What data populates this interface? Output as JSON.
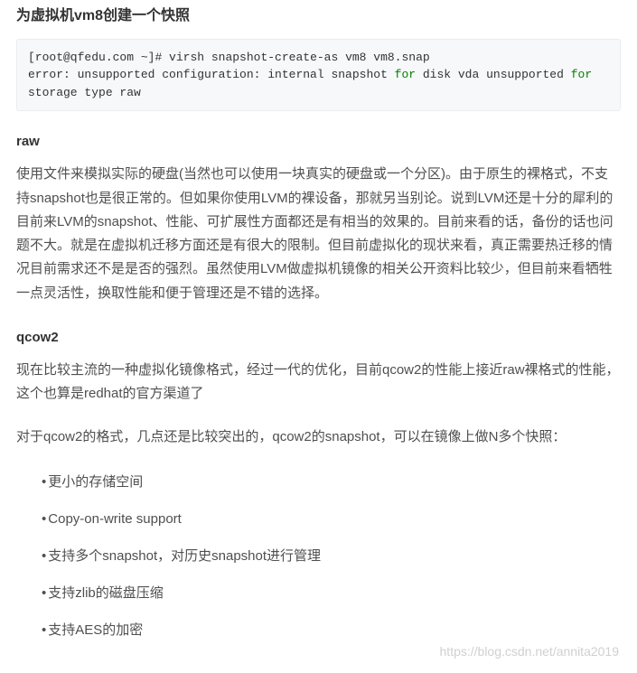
{
  "title": "为虚拟机vm8创建一个快照",
  "code": {
    "prompt": "[root@qfedu.com ~]",
    "command": "# virsh snapshot-create-as vm8 vm8.snap",
    "err_pre": "error: unsupported configuration: internal snapshot ",
    "kw1": "for",
    "err_mid": " disk vda unsupported ",
    "kw2": "for",
    "err_post": " storage type raw"
  },
  "raw": {
    "heading": "raw",
    "para": "使用文件来模拟实际的硬盘(当然也可以使用一块真实的硬盘或一个分区)。由于原生的裸格式，不支持snapshot也是很正常的。但如果你使用LVM的裸设备，那就另当别论。说到LVM还是十分的犀利的目前来LVM的snapshot、性能、可扩展性方面都还是有相当的效果的。目前来看的话，备份的话也问题不大。就是在虚拟机迁移方面还是有很大的限制。但目前虚拟化的现状来看，真正需要热迁移的情况目前需求还不是是否的强烈。虽然使用LVM做虚拟机镜像的相关公开资料比较少，但目前来看牺牲一点灵活性，换取性能和便于管理还是不错的选择。"
  },
  "qcow2": {
    "heading": "qcow2",
    "para1": "现在比较主流的一种虚拟化镜像格式，经过一代的优化，目前qcow2的性能上接近raw裸格式的性能，这个也算是redhat的官方渠道了",
    "para2": "对于qcow2的格式，几点还是比较突出的，qcow2的snapshot，可以在镜像上做N多个快照：",
    "items": [
      "更小的存储空间",
      "Copy-on-write support",
      "支持多个snapshot，对历史snapshot进行管理",
      "支持zlib的磁盘压缩",
      "支持AES的加密"
    ]
  },
  "watermark": "https://blog.csdn.net/annita2019"
}
